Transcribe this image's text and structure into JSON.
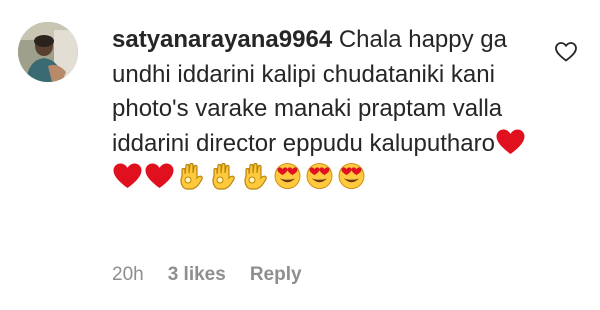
{
  "comment": {
    "username": "satyanarayana9964",
    "text": " Chala happy ga undhi iddarini kalipi chudataniki kani photo's varake manaki praptam valla iddarini director eppudu kaluputharo",
    "emoji": {
      "trailing": "red-heart",
      "line": [
        "red-heart",
        "red-heart",
        "ok-hand",
        "ok-hand",
        "ok-hand",
        "heart-eyes",
        "heart-eyes",
        "heart-eyes"
      ]
    },
    "time": "20h",
    "likes": "3 likes",
    "reply_label": "Reply"
  },
  "icons": {
    "like": "heart-outline-icon",
    "avatar": "user-avatar"
  },
  "colors": {
    "text": "#262626",
    "meta": "#8e8e8e",
    "heart_red": "#e0101f",
    "emoji_yellow": "#ffc83d"
  }
}
